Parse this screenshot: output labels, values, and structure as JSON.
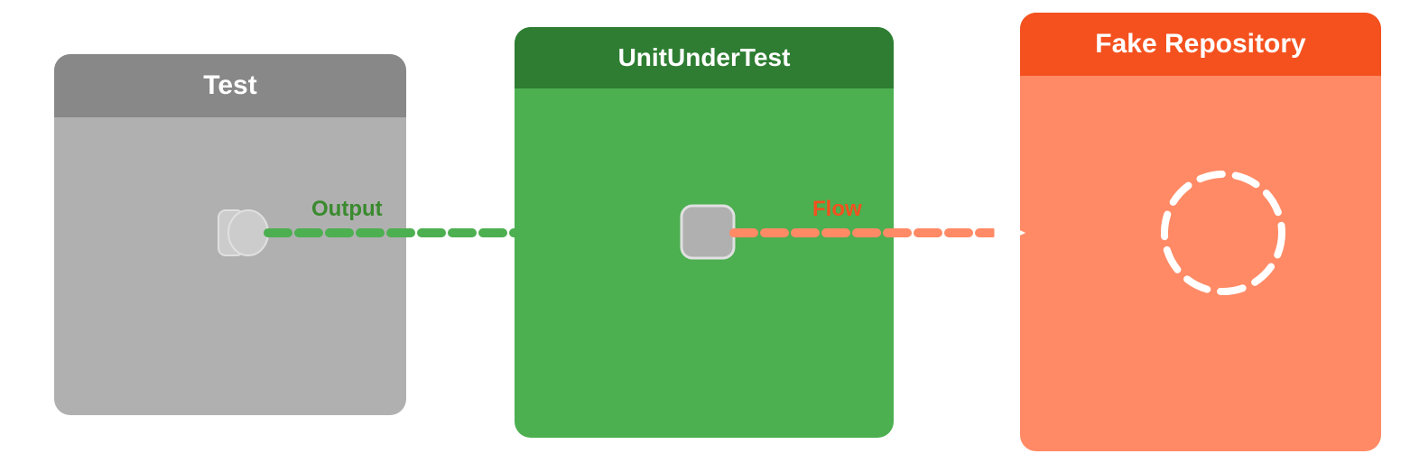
{
  "boxes": {
    "test": {
      "title": "Test",
      "header_bg": "#888888",
      "body_bg": "#b0b0b0"
    },
    "unit": {
      "title": "UnitUnderTest",
      "header_bg": "#2e7d32",
      "body_bg": "#4caf50"
    },
    "fake": {
      "title": "Fake Repository",
      "header_bg": "#f4511e",
      "body_bg": "#ff8a65"
    }
  },
  "labels": {
    "output": "Output",
    "flow": "Flow"
  },
  "colors": {
    "green_line": "#4caf50",
    "orange_line": "#f4511e",
    "white": "#ffffff"
  }
}
